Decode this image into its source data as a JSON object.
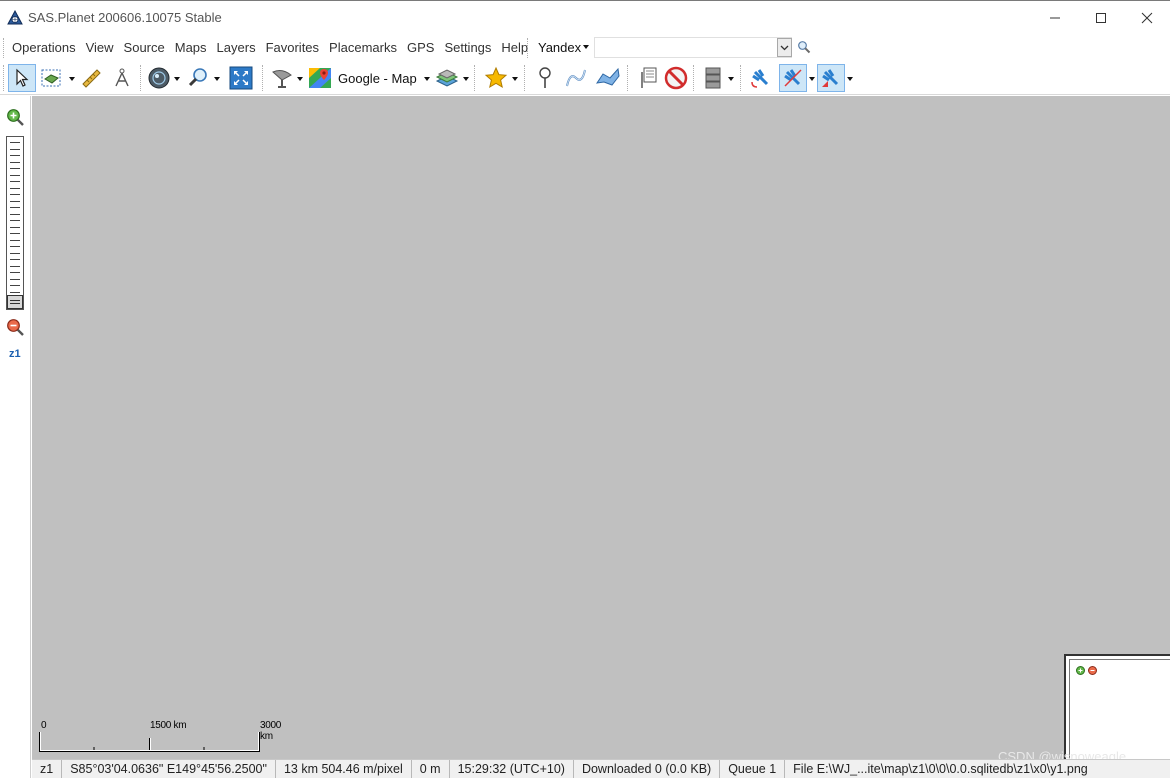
{
  "window": {
    "title": "SAS.Planet 200606.10075 Stable",
    "minimize_icon": "minimize-icon",
    "maximize_icon": "maximize-icon",
    "close_icon": "close-icon"
  },
  "menu": {
    "items": [
      "Operations",
      "View",
      "Source",
      "Maps",
      "Layers",
      "Favorites",
      "Placemarks",
      "GPS",
      "Settings",
      "Help"
    ]
  },
  "search": {
    "engine": "Yandex",
    "value": "",
    "placeholder": ""
  },
  "toolbar": {
    "map_source_label": "Google - Map",
    "icons": [
      "pointer-icon",
      "selection-icon",
      "ruler-icon",
      "compass-icon",
      "globe-icon",
      "zoom-magnifier-icon",
      "fullscreen-icon",
      "satellite-dish-icon",
      "google-maps-icon",
      "layers-icon",
      "favorites-star-icon",
      "placemark-pin-icon",
      "path-icon",
      "polygon-icon",
      "placemark-list-icon",
      "stop-icon",
      "cache-storage-icon",
      "gps-icon",
      "gps-track-icon",
      "gps-center-icon"
    ]
  },
  "zoom": {
    "level_label": "z1",
    "position": 0,
    "zoom_in_icon": "zoom-in-icon",
    "zoom_out_icon": "zoom-out-icon"
  },
  "scale": {
    "labels": [
      "0",
      "1500 km",
      "3000 km"
    ]
  },
  "watermark": "CSDN @wisnoweagle",
  "status": {
    "zoom": "z1",
    "coordinates": "S85°03'04.0636\" E149°45'56.2500\"",
    "resolution": "13 km 504.46 m/pixel",
    "elevation": "0 m",
    "time": "15:29:32 (UTC+10)",
    "downloaded": "Downloaded 0 (0.0 KB)",
    "queue": "Queue 1",
    "file": "File E:\\WJ_...ite\\map\\z1\\0\\0\\0.0.sqlitedb\\z1\\x0\\y1.png"
  },
  "colors": {
    "map_background": "#c0c0c0",
    "selection_highlight": "#cde6f7",
    "zoom_label": "#1b5fb0"
  }
}
